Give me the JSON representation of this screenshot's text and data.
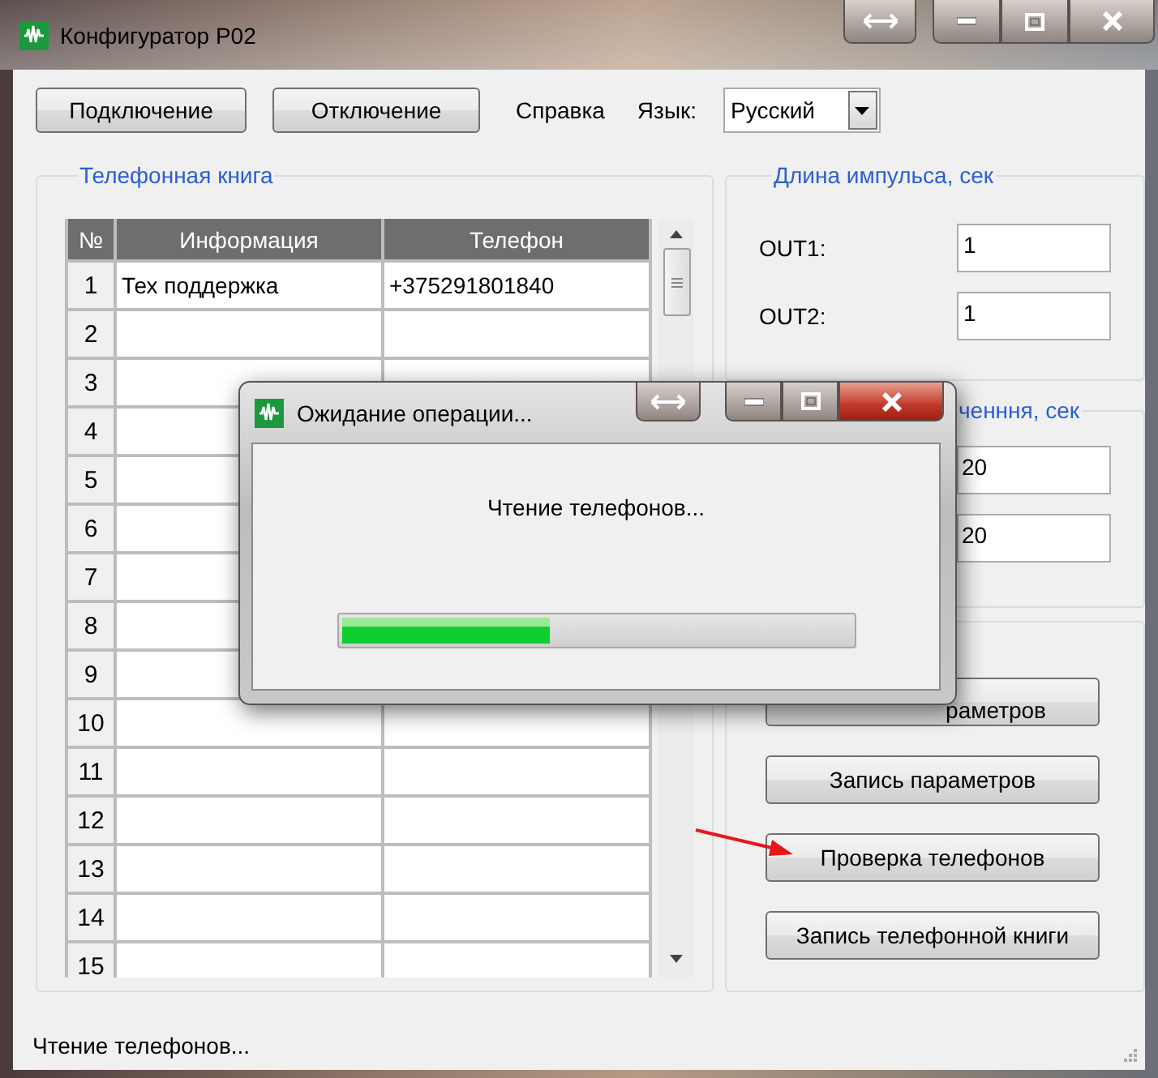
{
  "window": {
    "title": "Конфигуратор P02"
  },
  "toolbar": {
    "buttons": [
      "Подключение",
      "Отключение"
    ],
    "menu": "Справка",
    "language_label": "Язык:",
    "language_value": "Русский"
  },
  "phonebook": {
    "title": "Телефонная книга",
    "columns": [
      "№",
      "Информация",
      "Телефон"
    ],
    "rows": [
      {
        "number": "1",
        "info": "Тех поддержка",
        "phone": "+375291801840"
      },
      {
        "number": "2"
      },
      {
        "number": "3"
      },
      {
        "number": "4"
      },
      {
        "number": "5"
      },
      {
        "number": "6"
      },
      {
        "number": "7"
      },
      {
        "number": "8"
      },
      {
        "number": "9"
      },
      {
        "number": "10"
      },
      {
        "number": "11"
      },
      {
        "number": "12"
      },
      {
        "number": "13"
      },
      {
        "number": "14"
      },
      {
        "number": "15"
      }
    ]
  },
  "pulse": {
    "title": "Длина импульса, сек",
    "fields": [
      {
        "label": "OUT1:",
        "value": "1"
      },
      {
        "label": "OUT2:",
        "value": "1"
      }
    ]
  },
  "group_2": {
    "title": "ченння, сек",
    "fields": [
      {
        "value": "20"
      },
      {
        "value": "20"
      }
    ]
  },
  "actions": {
    "buttons": [
      "раметров",
      "Запись параметров",
      "Проверка телефонов",
      "Запись телефонной книги"
    ]
  },
  "status_bar": {
    "text": "Чтение телефонов..."
  },
  "dialog": {
    "title": "Ожидание операции...",
    "message": "Чтение телефонов...",
    "progress": {
      "level": 0.41
    }
  }
}
